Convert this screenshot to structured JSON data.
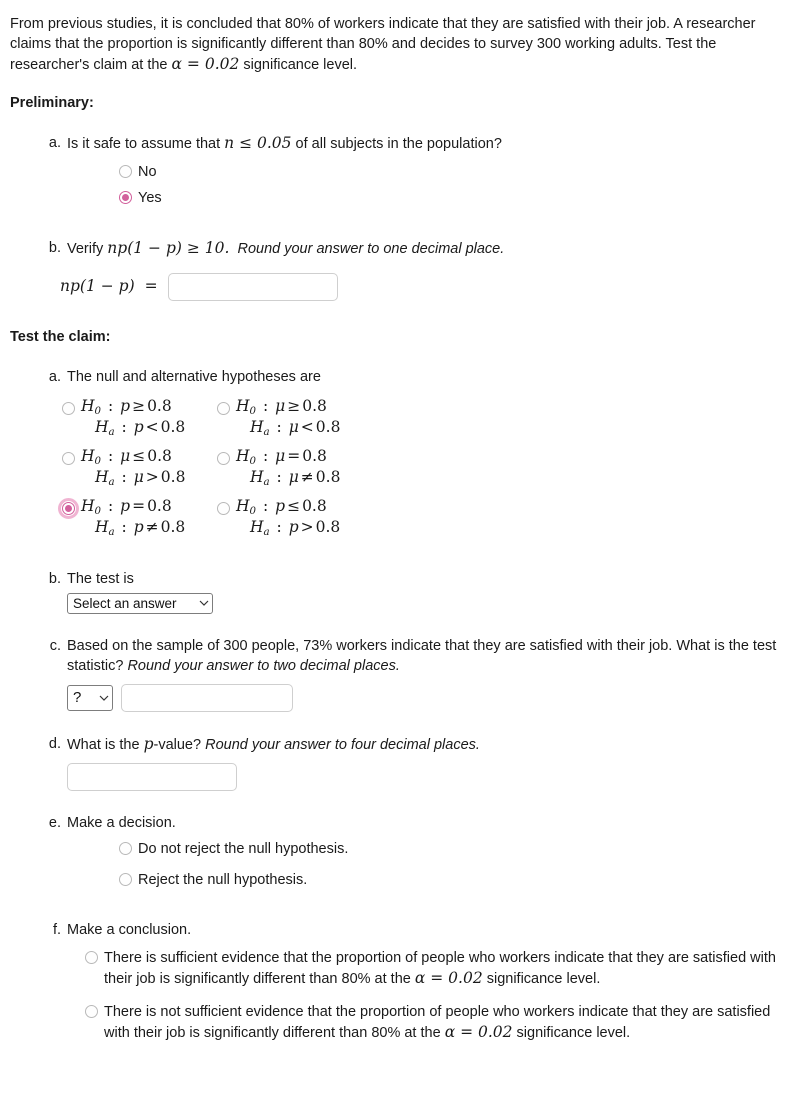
{
  "intro": {
    "text_1": "From previous studies, it is concluded that 80% of workers indicate that they are satisfied with their job. A researcher claims that the proportion is significantly different than 80% and decides to survey 300 working adults. Test the researcher's claim at the ",
    "alpha_sym": "α",
    "alpha_eq": " = ",
    "alpha_val": "0.02",
    "text_2": " significance level."
  },
  "preliminary": {
    "heading": "Preliminary:",
    "a": {
      "marker": "a.",
      "text_before": "Is it safe to assume that ",
      "n_sym": "n",
      "le_sym": " ≤ ",
      "threshold": "0.05",
      "text_after": " of all subjects in the population?",
      "options": [
        {
          "label": "No",
          "selected": false
        },
        {
          "label": "Yes",
          "selected": true
        }
      ]
    },
    "b": {
      "marker": "b.",
      "verify_word": "Verify ",
      "expr": "np(1 − p)",
      "ge_sym": " ≥ ",
      "ge_val": "10.",
      "hint": "Round your answer to one decimal place.",
      "eq_label_expr": "np(1 − p)",
      "eq_sign": " = ",
      "input_value": "",
      "input_placeholder": ""
    }
  },
  "test_claim": {
    "heading": "Test the claim:",
    "a": {
      "marker": "a.",
      "text": "The null and alternative hypotheses are",
      "options": [
        {
          "id": "opt-1",
          "null_param": "p",
          "null_rel": "≥",
          "null_val": "0.8",
          "alt_param": "p",
          "alt_rel": "<",
          "alt_val": "0.8",
          "selected": false,
          "focused": false
        },
        {
          "id": "opt-2",
          "null_param": "μ",
          "null_rel": "≥",
          "null_val": "0.8",
          "alt_param": "μ",
          "alt_rel": "<",
          "alt_val": "0.8",
          "selected": false,
          "focused": false
        },
        {
          "id": "opt-3",
          "null_param": "μ",
          "null_rel": "≤",
          "null_val": "0.8",
          "alt_param": "μ",
          "alt_rel": ">",
          "alt_val": "0.8",
          "selected": false,
          "focused": false
        },
        {
          "id": "opt-4",
          "null_param": "μ",
          "null_rel": "=",
          "null_val": "0.8",
          "alt_param": "μ",
          "alt_rel": "≠",
          "alt_val": "0.8",
          "selected": false,
          "focused": false
        },
        {
          "id": "opt-5",
          "null_param": "p",
          "null_rel": "=",
          "null_val": "0.8",
          "alt_param": "p",
          "alt_rel": "≠",
          "alt_val": "0.8",
          "selected": true,
          "focused": true
        },
        {
          "id": "opt-6",
          "null_param": "p",
          "null_rel": "≤",
          "null_val": "0.8",
          "alt_param": "p",
          "alt_rel": ">",
          "alt_val": "0.8",
          "selected": false,
          "focused": false
        }
      ],
      "h0_label": "H",
      "h0_sub": "0",
      "ha_label": "H",
      "ha_sub": "a",
      "colon": " : "
    },
    "b": {
      "marker": "b.",
      "text": "The test is",
      "select_value": "Select an answer"
    },
    "c": {
      "marker": "c.",
      "text_plain": "Based on the sample of 300 people, 73% workers indicate that they are satisfied with their job. What is the test statistic? ",
      "hint": "Round your answer to two decimal places.",
      "select_value": "?",
      "input_value": "",
      "input_placeholder": ""
    },
    "d": {
      "marker": "d.",
      "text_before": "What is the ",
      "p_sym": "p",
      "text_after": "-value? ",
      "hint": "Round your answer to four decimal places.",
      "input_value": "",
      "input_placeholder": ""
    },
    "e": {
      "marker": "e.",
      "text": "Make a decision.",
      "options": [
        {
          "label": "Do not reject the null hypothesis.",
          "selected": false
        },
        {
          "label": "Reject the null hypothesis.",
          "selected": false
        }
      ]
    },
    "f": {
      "marker": "f.",
      "text": "Make a conclusion.",
      "options": [
        {
          "part_1": "There is sufficient evidence that the proportion of people who workers indicate that they are satisfied with their job is significantly different than 80% at the ",
          "alpha_sym": "α",
          "alpha_eq": " = ",
          "alpha_val": "0.02",
          "part_2": " significance level.",
          "selected": false
        },
        {
          "part_1": "There is not sufficient evidence that the proportion of people who workers indicate that they are satisfied with their job is significantly different than 80% at the ",
          "alpha_sym": "α",
          "alpha_eq": " = ",
          "alpha_val": "0.02",
          "part_2": " significance level.",
          "selected": false
        }
      ]
    }
  },
  "icons": {
    "chevron_down": "chevron-down-icon"
  },
  "colors": {
    "accent_pink": "#d2609c",
    "focus_ring": "#f0b4d2",
    "input_border": "#cfcfcf",
    "select_border": "#7d7d7d",
    "radio_border": "#b9b9b9"
  }
}
